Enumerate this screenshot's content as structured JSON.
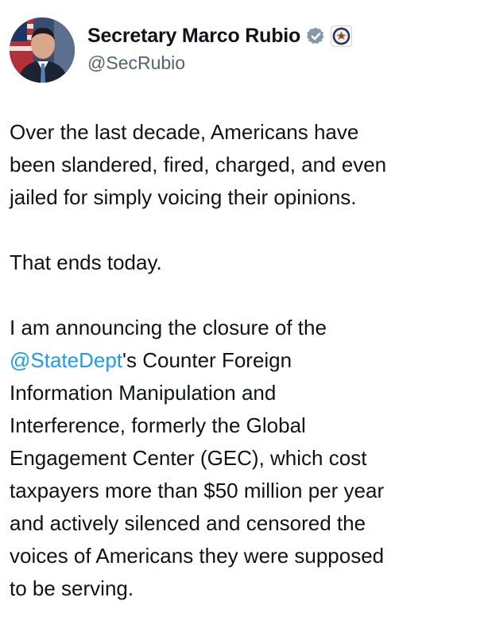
{
  "author": {
    "display_name": "Secretary Marco Rubio",
    "handle": "@SecRubio",
    "verified_icon": "verified-badge-icon",
    "affiliation_icon": "state-department-seal-icon"
  },
  "tweet": {
    "paragraph1": [
      "Over the last decade, Americans have",
      "been slandered, fired, charged, and even",
      "jailed for simply voicing their opinions."
    ],
    "paragraph2": "That ends today.",
    "paragraph3": {
      "line1": "I am announcing the closure of the",
      "mention": "@StateDept",
      "line2_rest": "'s Counter Foreign",
      "lines": [
        "Information Manipulation and",
        "Interference, formerly the Global",
        "Engagement Center (GEC), which cost",
        "taxpayers more than $50 million per year",
        "and actively silenced and censored the",
        "voices of Americans they were supposed",
        "to be serving."
      ]
    }
  },
  "colors": {
    "link": "#1d9bf0",
    "text": "#0f1419",
    "secondary_text": "#536471",
    "verified_badge": "#829aab"
  }
}
